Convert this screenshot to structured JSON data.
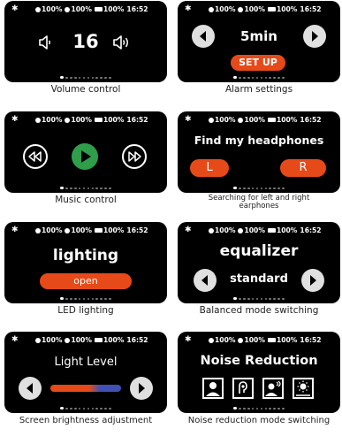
{
  "status": {
    "bt_symbol": "✱",
    "battery_a": "100%",
    "battery_b": "100%",
    "battery_c": "100%",
    "time": "16:52"
  },
  "colors": {
    "accent": "#e64a19",
    "play": "#2e9e4a",
    "screen_bg": "#000000",
    "slider_start": "#e64a19",
    "slider_end": "#3f51b5"
  },
  "panels": {
    "volume": {
      "value": "16",
      "caption": "Volume control"
    },
    "alarm": {
      "value": "5min",
      "button": "SET UP",
      "caption": "Alarm settings"
    },
    "music": {
      "caption": "Music control"
    },
    "find": {
      "title": "Find my headphones",
      "left": "L",
      "right": "R",
      "caption": "Searching for left and right earphones"
    },
    "lighting": {
      "title": "lighting",
      "button": "open",
      "caption": "LED lighting"
    },
    "equalizer": {
      "title": "equalizer",
      "value": "standard",
      "caption": "Balanced mode switching"
    },
    "brightness": {
      "title": "Light Level",
      "caption": "Screen brightness adjustment"
    },
    "noise": {
      "title": "Noise Reduction",
      "caption": "Noise reduction mode switching"
    }
  },
  "icons": [
    "bluetooth-icon",
    "battery-icon",
    "speaker-low-icon",
    "speaker-high-icon",
    "chevron-left-icon",
    "chevron-right-icon",
    "rewind-icon",
    "play-icon",
    "fast-forward-icon",
    "person-icon",
    "ear-icon",
    "person-voice-icon",
    "sun-icon"
  ]
}
